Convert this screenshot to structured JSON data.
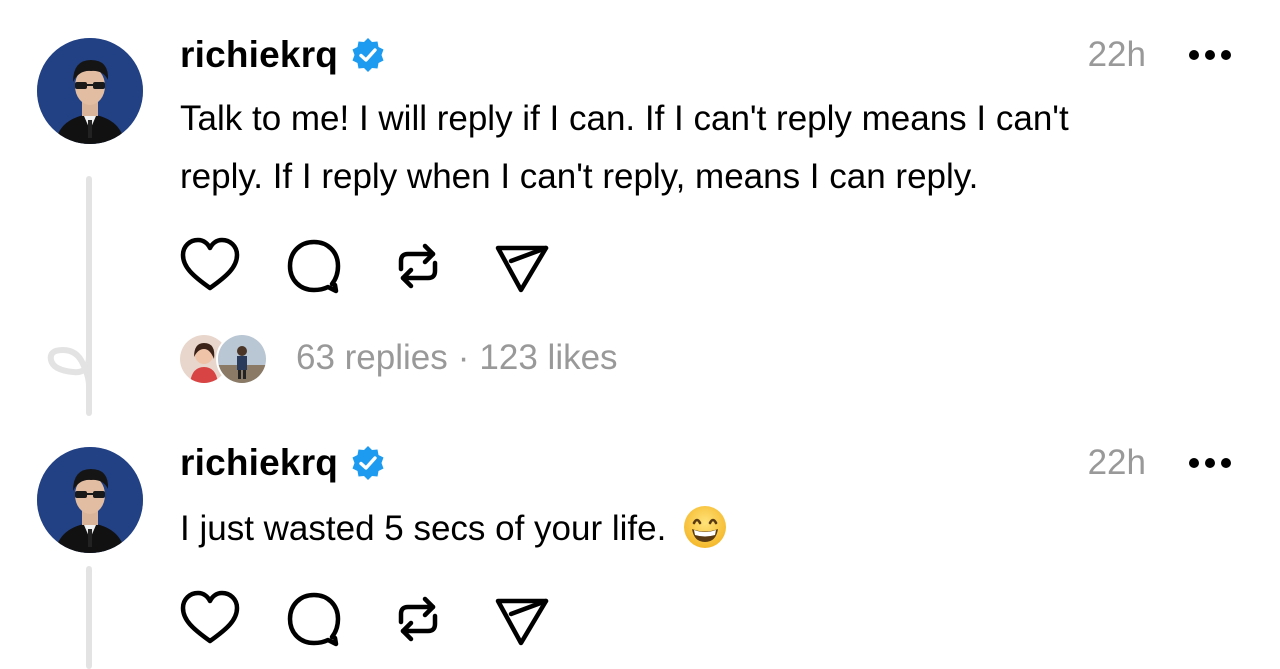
{
  "posts": [
    {
      "username": "richiekrq",
      "time": "22h",
      "text_lines": [
        "Talk to me! I will reply if I can. If I can't reply means I can't",
        "reply. If I reply when I can't reply, means I can reply."
      ],
      "replies": "63 replies",
      "separator": "·",
      "likes": "123 likes"
    },
    {
      "username": "richiekrq",
      "time": "22h",
      "text": "I just wasted 5 secs of your life.",
      "emoji": "grinning-face-with-smiling-eyes"
    }
  ],
  "icons": {
    "like": "heart-icon",
    "reply": "comment-icon",
    "repost": "repost-icon",
    "share": "send-icon",
    "more": "more-icon",
    "verified": "verified-badge-icon"
  },
  "colors": {
    "verified": "#1d9bf0",
    "muted": "#999999",
    "thread_line": "#e3e3e3",
    "avatar_bg": "#1f3a7a"
  }
}
